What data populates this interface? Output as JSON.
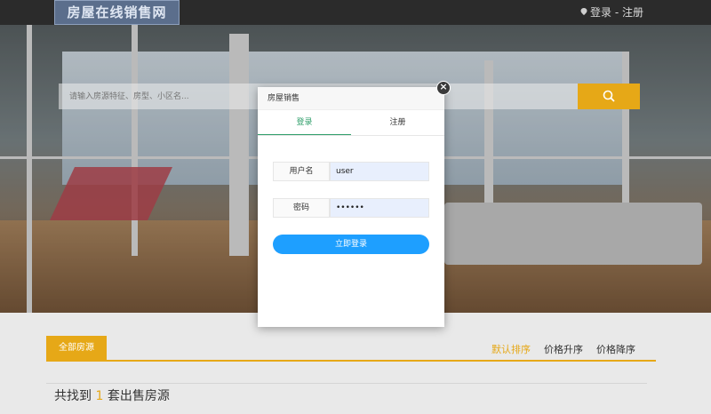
{
  "header": {
    "logo_text": "房屋在线销售网",
    "auth_text": "登录 - 注册"
  },
  "search": {
    "placeholder": "请输入房源特征、房型、小区名..."
  },
  "listing": {
    "tab_all": "全部房源",
    "sort_default": "默认排序",
    "sort_price_asc": "价格升序",
    "sort_price_desc": "价格降序",
    "count_prefix": "共找到",
    "count_value": "1",
    "count_suffix": "套出售房源"
  },
  "modal": {
    "title": "房屋销售",
    "tab_login": "登录",
    "tab_register": "注册",
    "username_label": "用户名",
    "username_value": "user",
    "password_label": "密码",
    "password_value": "••••••",
    "submit_label": "立即登录",
    "close_label": "×"
  },
  "colors": {
    "accent": "#e6a817",
    "primary_button": "#1e9fff",
    "active_tab": "#2f9e6a"
  }
}
